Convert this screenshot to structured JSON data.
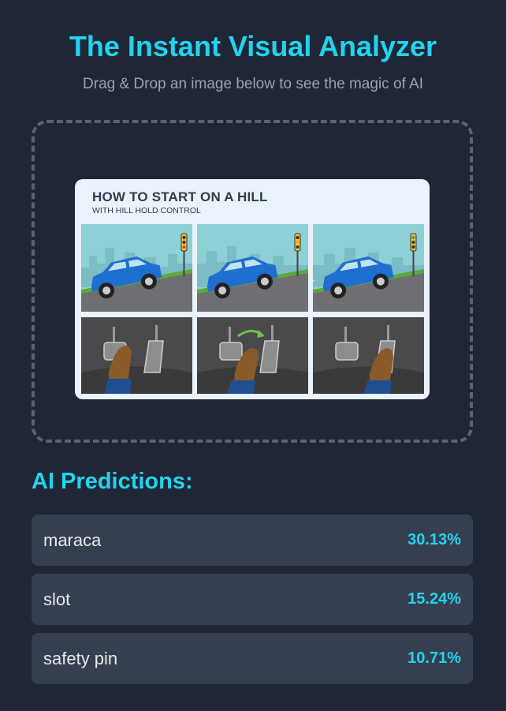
{
  "header": {
    "title": "The Instant Visual Analyzer",
    "subtitle": "Drag & Drop an image below to see the magic of AI"
  },
  "preview_image": {
    "title": "HOW TO START ON A HILL",
    "subtitle": "WITH HILL HOLD CONTROL"
  },
  "predictions": {
    "heading": "AI Predictions:",
    "items": [
      {
        "label": "maraca",
        "value": "30.13%"
      },
      {
        "label": "slot",
        "value": "15.24%"
      },
      {
        "label": "safety pin",
        "value": "10.71%"
      }
    ]
  },
  "colors": {
    "background": "#1f2736",
    "accent": "#22d3ee",
    "card": "#363f4f"
  }
}
